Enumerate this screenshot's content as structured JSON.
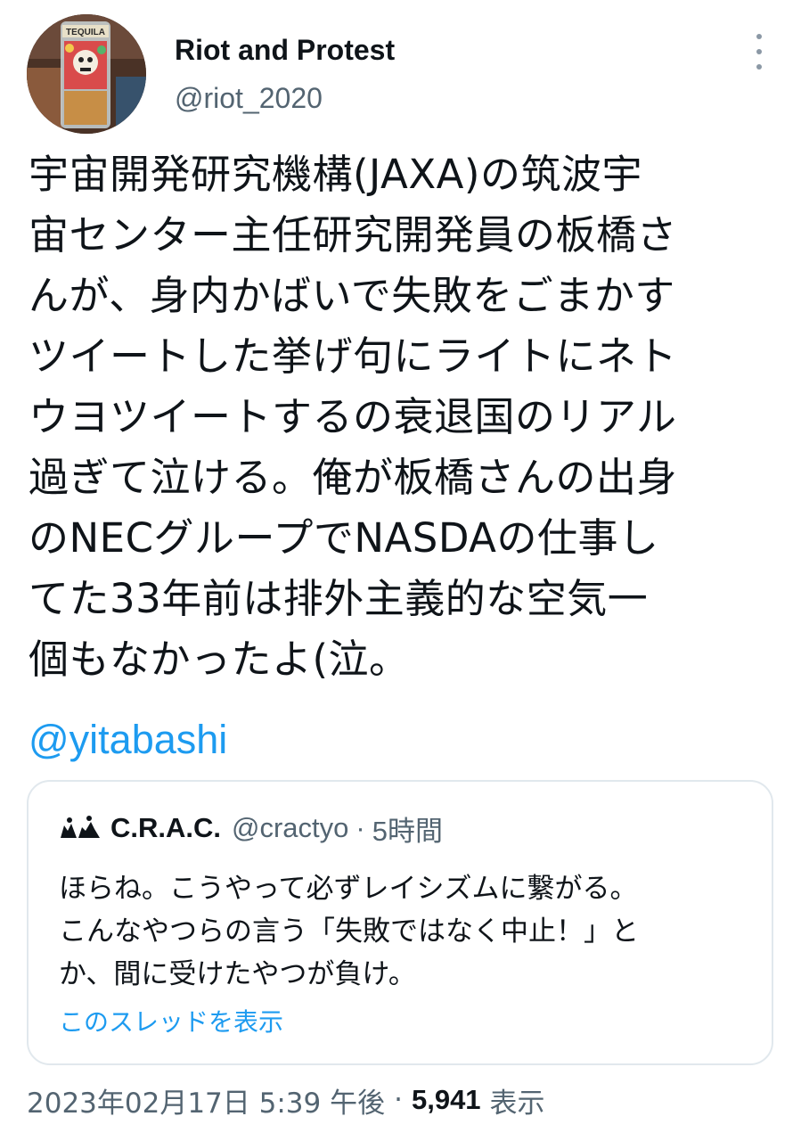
{
  "author": {
    "display_name": "Riot and Protest",
    "handle": "@riot_2020",
    "avatar_label": "TEQUILA"
  },
  "tweet": {
    "lines": [
      "宇宙開発研究機構(JAXA)の筑波宇",
      "宙センター主任研究開発員の板橋さ",
      "んが、身内かばいで失敗をごまかす",
      "ツイートした挙げ句にライトにネト",
      "ウヨツイートするの衰退国のリアル",
      "過ぎて泣ける。俺が板橋さんの出身",
      "のNECグループでNASDAの仕事し",
      "てた33年前は排外主義的な空気一",
      "個もなかったよ(泣。"
    ],
    "mention": "@yitabashi"
  },
  "quote": {
    "name": "C.R.A.C.",
    "handle": "@cractyo",
    "separator": "·",
    "time": "5時間",
    "lines": [
      "ほらね。こうやって必ずレイシズムに繋がる。",
      "こんなやつらの言う「失敗ではなく中止！」と",
      "か、間に受けたやつが負け。"
    ],
    "show_thread": "このスレッドを表示"
  },
  "meta": {
    "timestamp": "2023年02月17日 5:39 午後",
    "separator": "·",
    "views_count": "5,941",
    "views_label": "表示"
  },
  "colors": {
    "link": "#1d9bf0",
    "secondary_text": "#536471",
    "primary_text": "#0f1419",
    "border": "#e1e8ed"
  }
}
